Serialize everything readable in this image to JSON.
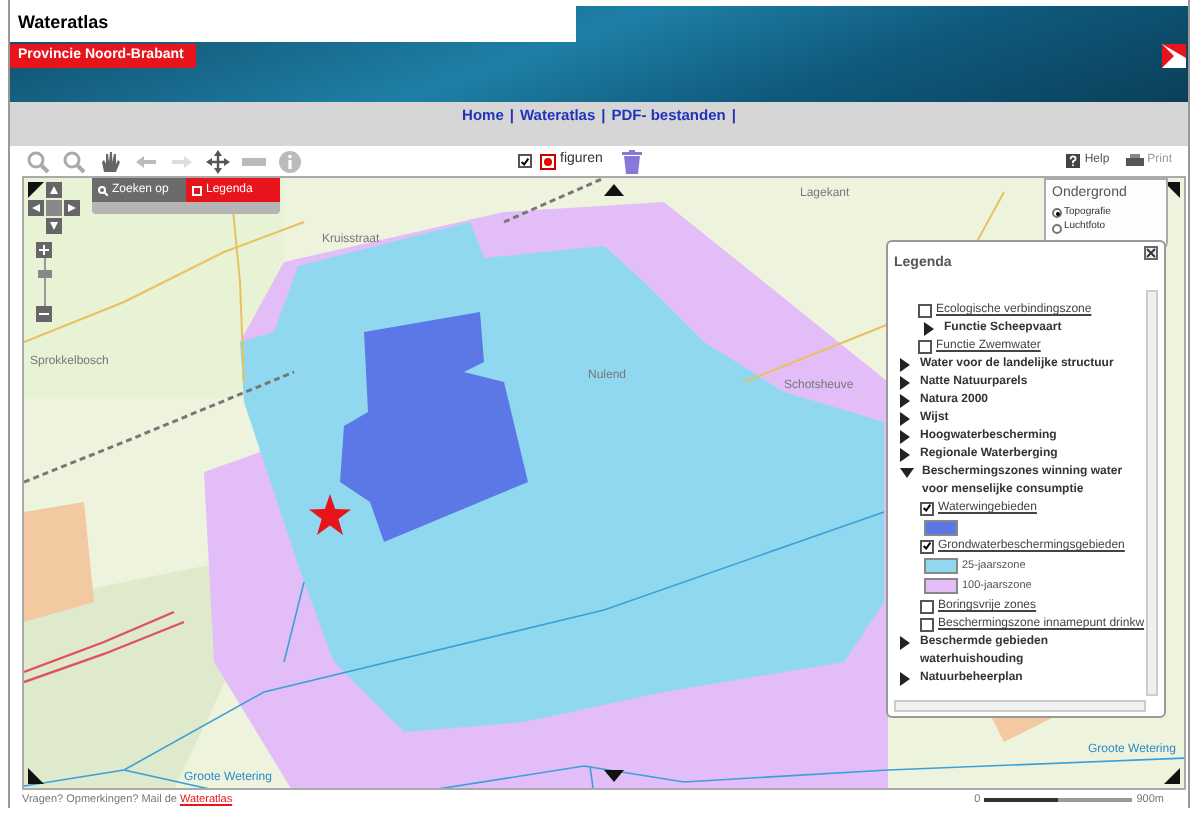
{
  "header": {
    "title": "Wateratlas",
    "organisation": "Provincie Noord-Brabant"
  },
  "nav": [
    {
      "label": "Home"
    },
    {
      "label": "Wateratlas"
    },
    {
      "label": "PDF- bestanden"
    }
  ],
  "nav_separator": "|",
  "toolbar": {
    "figures": {
      "label": "figuren",
      "checked": true
    },
    "help": "Help",
    "print": "Print"
  },
  "map_tabs": [
    {
      "label": "Zoeken op",
      "selected": false
    },
    {
      "label": "Legenda",
      "selected": true
    }
  ],
  "map_labels": [
    {
      "text": "Kruisstraat"
    },
    {
      "text": "Lagekant"
    },
    {
      "text": "Sprokkelbosch"
    },
    {
      "text": "Nulend"
    },
    {
      "text": "Schotsheuve"
    },
    {
      "text": "Groote Wetering"
    },
    {
      "text": "Groote Wetering"
    }
  ],
  "basemap": {
    "title": "Ondergrond",
    "options": [
      {
        "label": "Topografie",
        "selected": true
      },
      {
        "label": "Luchtfoto",
        "selected": false
      }
    ]
  },
  "legend": {
    "title": "Legenda",
    "scrolled_children": [
      {
        "kind": "checkbox",
        "label": "Ecologische verbindingszone",
        "checked": false
      },
      {
        "kind": "group",
        "label": "Functie Scheepvaart",
        "expanded": false
      },
      {
        "kind": "checkbox",
        "label": "Functie Zwemwater",
        "checked": false
      }
    ],
    "items": [
      {
        "kind": "group",
        "label": "Water voor de landelijke structuur",
        "expanded": false
      },
      {
        "kind": "group",
        "label": "Natte Natuurparels",
        "expanded": false
      },
      {
        "kind": "group",
        "label": "Natura 2000",
        "expanded": false
      },
      {
        "kind": "group",
        "label": "Wijst",
        "expanded": false
      },
      {
        "kind": "group",
        "label": "Hoogwaterbescherming",
        "expanded": false
      },
      {
        "kind": "group",
        "label": "Regionale Waterberging",
        "expanded": false
      },
      {
        "kind": "group",
        "label": "Beschermingszones winning water voor menselijke consumptie",
        "expanded": true,
        "children": [
          {
            "kind": "checkbox",
            "label": "Waterwingebieden",
            "checked": true,
            "swatches": [
              {
                "color": "#5b78e6"
              }
            ]
          },
          {
            "kind": "checkbox",
            "label": "Grondwaterbeschermingsgebieden",
            "checked": true,
            "swatches": [
              {
                "color": "#8fd8f0",
                "label": "25-jaarszone"
              },
              {
                "color": "#e3bdf7",
                "label": "100-jaarszone"
              }
            ]
          },
          {
            "kind": "checkbox",
            "label": "Boringsvrije zones",
            "checked": false
          },
          {
            "kind": "checkbox",
            "label": "Beschermingszone innamepunt drinkw",
            "checked": false
          }
        ]
      },
      {
        "kind": "group",
        "label": "Beschermde gebieden waterhuishouding",
        "expanded": false
      },
      {
        "kind": "group",
        "label": "Natuurbeheerplan",
        "expanded": false
      }
    ]
  },
  "footer": {
    "text": "Vragen? Opmerkingen? Mail de",
    "link": "Wateratlas"
  },
  "scale_bar": {
    "start": "0",
    "end": "900m"
  },
  "zoom_slider": {
    "level": 0.7
  }
}
